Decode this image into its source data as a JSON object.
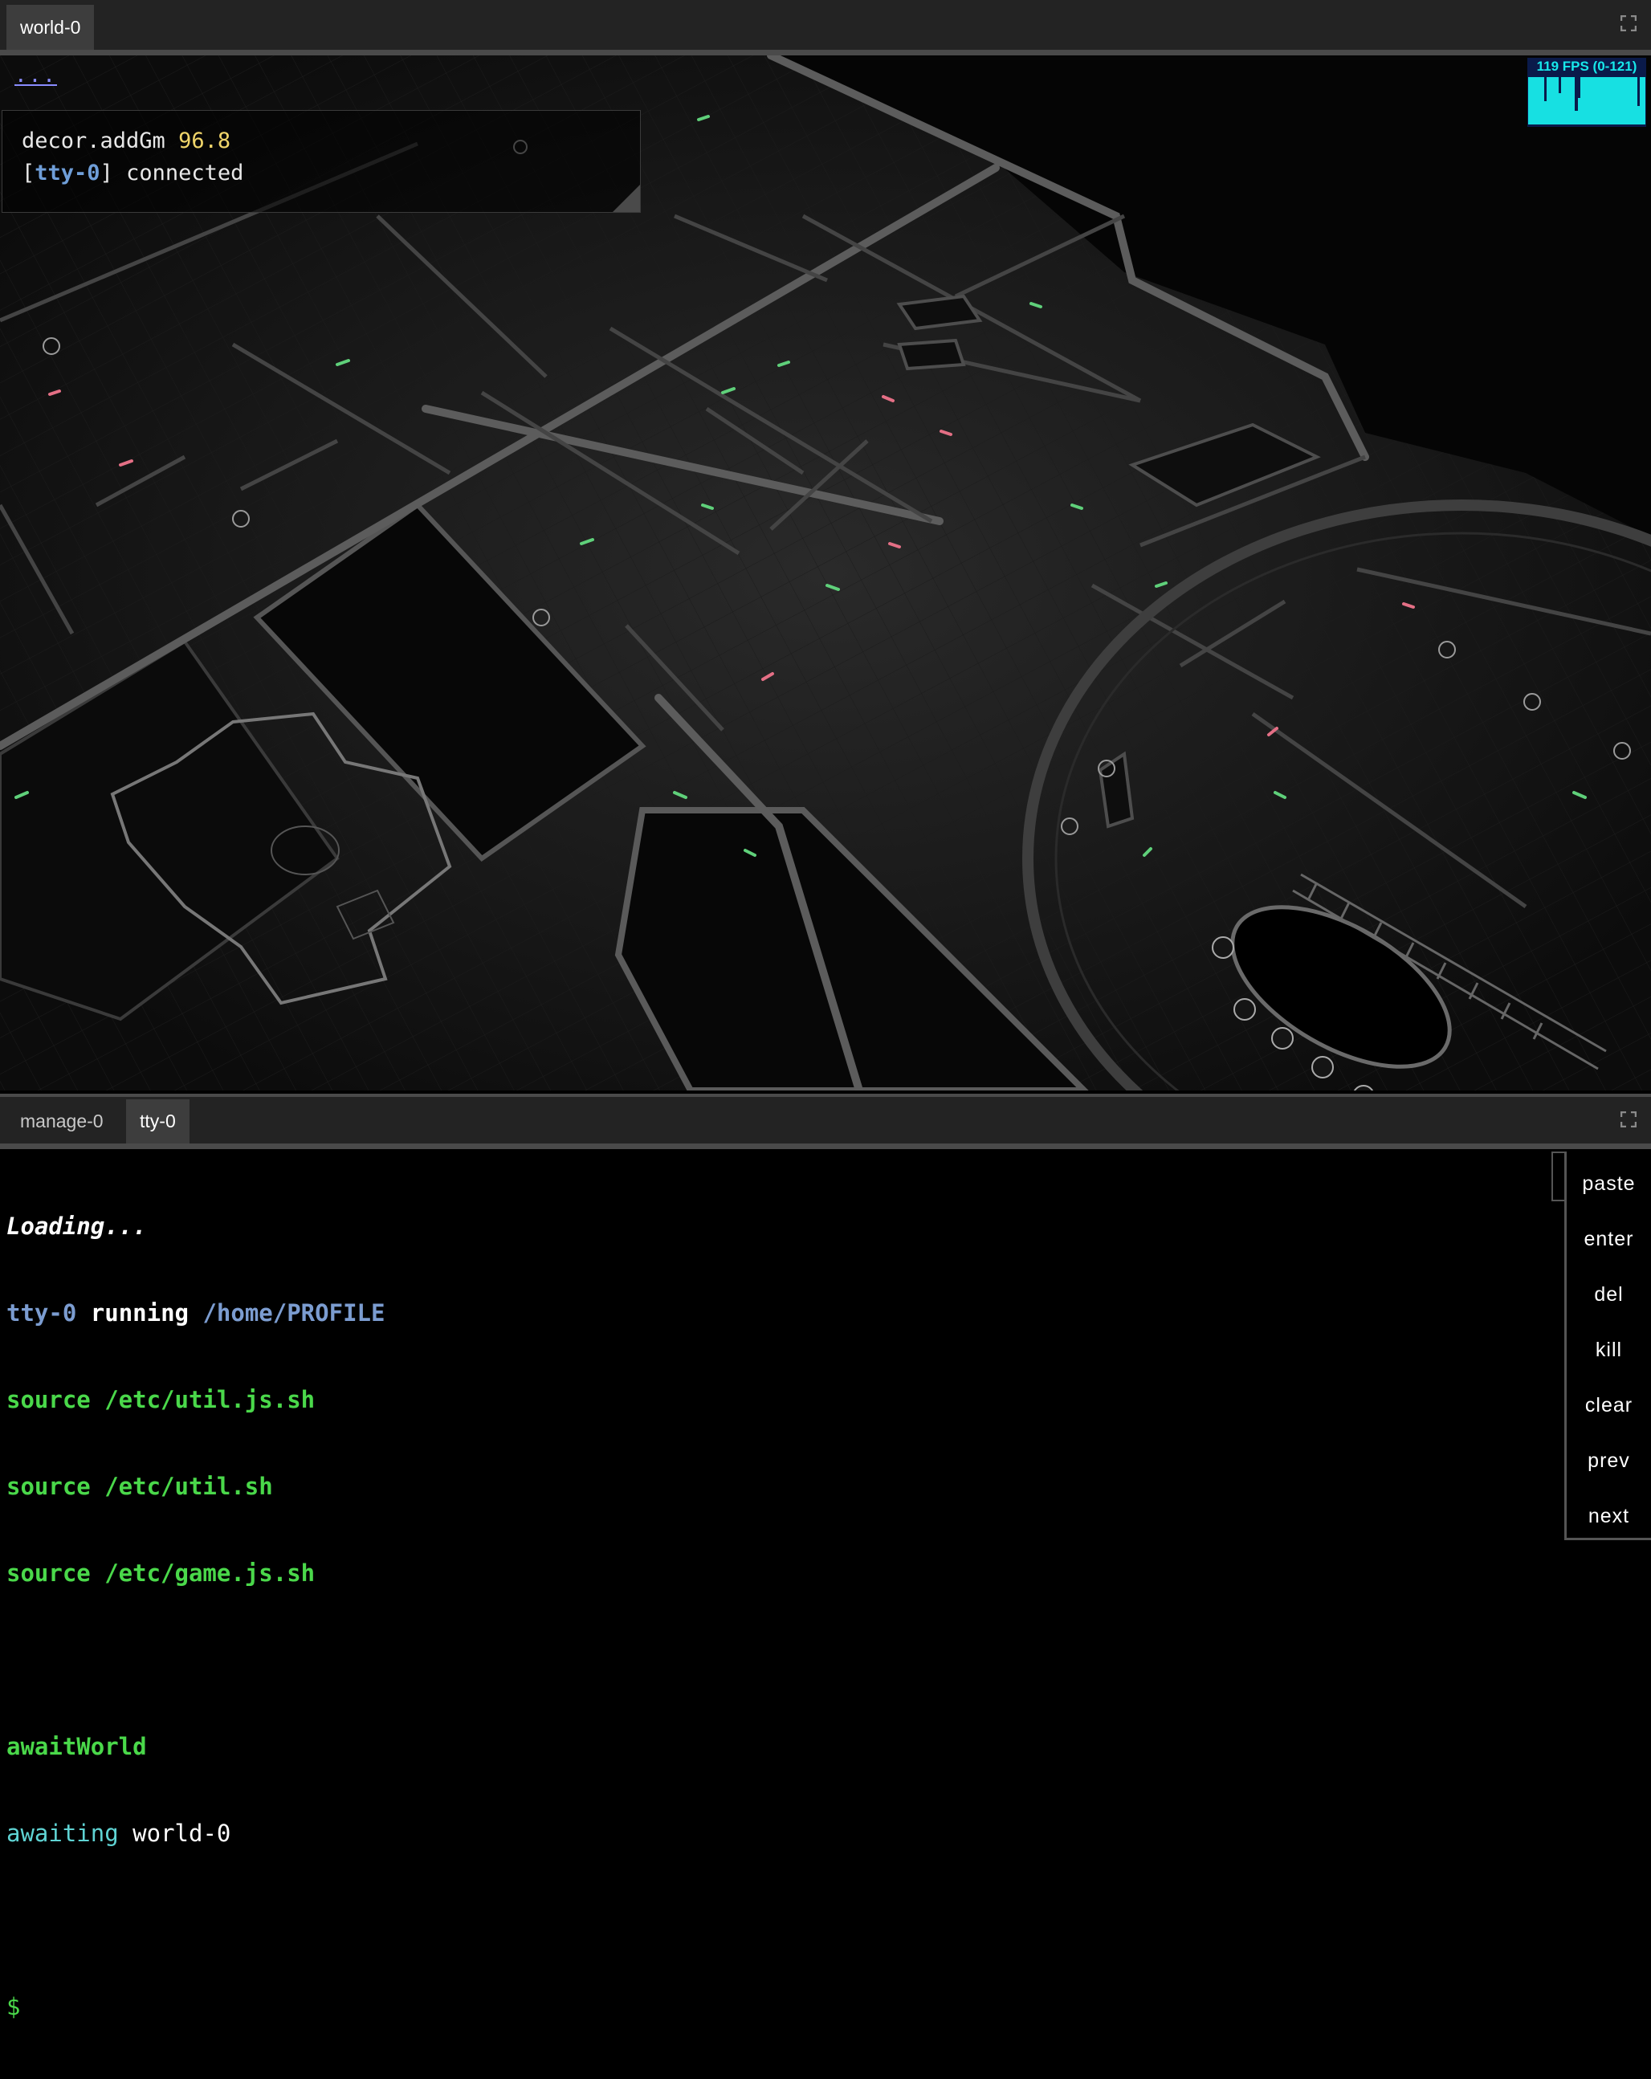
{
  "top_tabs": [
    {
      "label": "world-0",
      "active": true
    }
  ],
  "bottom_tabs": [
    {
      "label": "manage-0",
      "active": false
    },
    {
      "label": "tty-0",
      "active": true
    }
  ],
  "world": {
    "menu_dots": "...",
    "log": [
      {
        "text": "decor.addGm",
        "value": "96.8"
      },
      {
        "tty": "tty-0",
        "text": "connected"
      }
    ],
    "fps_label": "119 FPS (0-121)",
    "fps_color": "#17e0e2"
  },
  "terminal": {
    "lines": [
      "Loading...",
      "tty-0",
      "running",
      "/home/PROFILE",
      "source /etc/util.js.sh",
      "source /etc/util.sh",
      "source /etc/game.js.sh",
      "awaitWorld",
      "awaiting",
      "world-0",
      "$"
    ],
    "toggle": ">",
    "buttons": [
      "paste",
      "enter",
      "del",
      "kill",
      "clear",
      "prev",
      "next"
    ]
  },
  "icons": {
    "maximize": "maximize-icon"
  }
}
